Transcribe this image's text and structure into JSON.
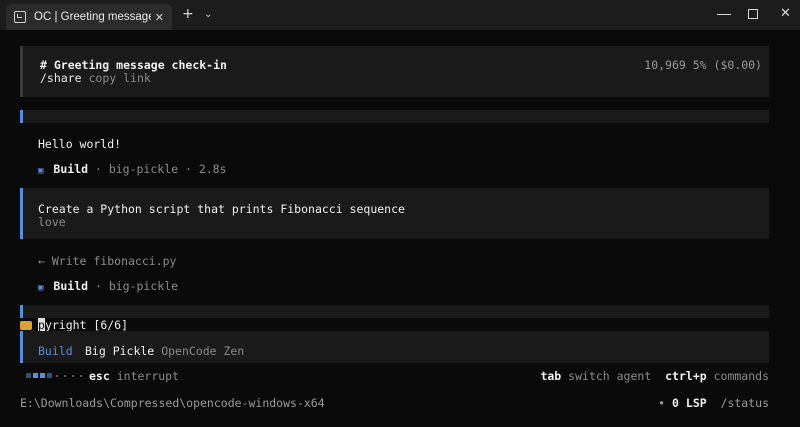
{
  "window": {
    "tab_title": "OC | Greeting message check-",
    "tab_close_glyph": "✕",
    "new_tab_glyph": "+",
    "dropdown_glyph": "⌄",
    "close_glyph": "✕"
  },
  "session": {
    "title": "# Greeting message check-in",
    "share_cmd": "/share",
    "share_hint": "copy link",
    "tokens": "10,969",
    "usage": "5% ($0.00)"
  },
  "messages": [
    {
      "text": "Hello world!"
    },
    {
      "agent": "Build",
      "meta": " · big-pickle · 2.8s"
    },
    {
      "prompt": "Create a Python script that prints Fibonacci sequence",
      "sub": "love"
    },
    {
      "tool": "← Write fibonacci.py"
    },
    {
      "agent": "Build",
      "meta": " · big-pickle"
    }
  ],
  "status_line": {
    "cursor_char": "p",
    "text": "yright [6/6]"
  },
  "input": {
    "agent": "Build",
    "model": "Big Pickle",
    "provider": "OpenCode Zen"
  },
  "hints": {
    "esc_key": "esc",
    "esc_label": "interrupt",
    "tab_key": "tab",
    "tab_label": "switch agent",
    "cmd_key": "ctrl+p",
    "cmd_label": "commands"
  },
  "footer": {
    "cwd": "E:\\Downloads\\Compressed\\opencode-windows-x64",
    "lsp_dot": "•",
    "lsp": "0 LSP",
    "status": "/status"
  },
  "colors": {
    "accent": "#5b8cd6",
    "panel": "#1a1a1a",
    "background": "#0a0a0a",
    "muted": "#8a8a8a"
  }
}
